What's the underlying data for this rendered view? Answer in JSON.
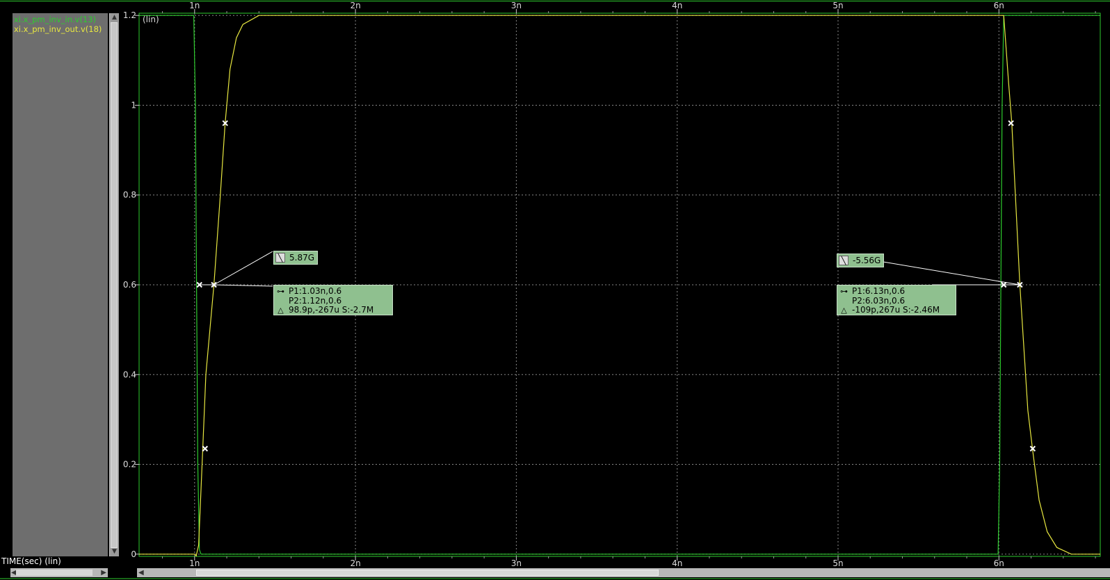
{
  "chart_data": {
    "type": "line",
    "xlabel": "TIME(sec) (lin)",
    "ylabel_unit": "(lin)",
    "xlim": [
      0.655,
      6.63
    ],
    "ylim": [
      -0.005,
      1.205
    ],
    "x_ticks": [
      {
        "value": 1,
        "label": "1n"
      },
      {
        "value": 2,
        "label": "2n"
      },
      {
        "value": 3,
        "label": "3n"
      },
      {
        "value": 4,
        "label": "4n"
      },
      {
        "value": 5,
        "label": "5n"
      },
      {
        "value": 6,
        "label": "6n"
      }
    ],
    "y_ticks": [
      {
        "value": 0,
        "label": "0"
      },
      {
        "value": 0.2,
        "label": "0.2"
      },
      {
        "value": 0.4,
        "label": "0.4"
      },
      {
        "value": 0.6,
        "label": "0.6"
      },
      {
        "value": 0.8,
        "label": "0.8"
      },
      {
        "value": 1,
        "label": "1"
      },
      {
        "value": 1.2,
        "label": "1.2"
      }
    ],
    "grid": true,
    "series": [
      {
        "name": "xi.x_pm_inv_in.v(13)",
        "color": "#2ecc2e",
        "points": [
          [
            0.655,
            1.2
          ],
          [
            0.995,
            1.2
          ],
          [
            1.005,
            1.0
          ],
          [
            1.012,
            0.6
          ],
          [
            1.02,
            0.2
          ],
          [
            1.03,
            0.01
          ],
          [
            1.04,
            0.0
          ],
          [
            5.995,
            0.0
          ],
          [
            6.005,
            0.2
          ],
          [
            6.012,
            0.6
          ],
          [
            6.02,
            1.0
          ],
          [
            6.03,
            1.2
          ],
          [
            6.63,
            1.2
          ]
        ]
      },
      {
        "name": "xi.x_pm_inv_out.v(18)",
        "color": "#e8e840",
        "points": [
          [
            0.655,
            0.0
          ],
          [
            1.0,
            0.0
          ],
          [
            1.01,
            -0.004
          ],
          [
            1.025,
            0.02
          ],
          [
            1.05,
            0.23
          ],
          [
            1.07,
            0.4
          ],
          [
            1.12,
            0.6
          ],
          [
            1.16,
            0.8
          ],
          [
            1.19,
            0.96
          ],
          [
            1.22,
            1.08
          ],
          [
            1.26,
            1.15
          ],
          [
            1.3,
            1.18
          ],
          [
            1.4,
            1.2
          ],
          [
            6.63,
            1.2
          ],
          [
            6.63,
            1.2
          ]
        ],
        "fall_points": [
          [
            6.0,
            1.2
          ],
          [
            6.03,
            1.2
          ],
          [
            6.06,
            1.05
          ],
          [
            6.08,
            0.96
          ],
          [
            6.13,
            0.6
          ],
          [
            6.18,
            0.32
          ],
          [
            6.21,
            0.23
          ],
          [
            6.25,
            0.12
          ],
          [
            6.3,
            0.05
          ],
          [
            6.36,
            0.015
          ],
          [
            6.45,
            0.0
          ],
          [
            6.5,
            0.0
          ]
        ]
      }
    ],
    "markers": [
      {
        "x": 1.03,
        "y": 0.6
      },
      {
        "x": 1.12,
        "y": 0.6
      },
      {
        "x": 1.19,
        "y": 0.96
      },
      {
        "x": 1.065,
        "y": 0.235
      },
      {
        "x": 6.03,
        "y": 0.6
      },
      {
        "x": 6.13,
        "y": 0.6
      },
      {
        "x": 6.075,
        "y": 0.96
      },
      {
        "x": 6.21,
        "y": 0.235
      }
    ],
    "annotations": [
      {
        "slope_label": "5.87G",
        "p1": "P1:1.03n,0.6",
        "p2": "P2:1.12n,0.6",
        "delta": "98.9p,-267u S:-2.7M"
      },
      {
        "slope_label": "-5.56G",
        "p1": "P1:6.13n,0.6",
        "p2": "P2:6.03n,0.6",
        "delta": "-109p,267u S:-2.46M"
      }
    ]
  },
  "legend": {
    "entries": [
      {
        "label": "xi.x_pm_inv_in.v(13)",
        "color": "#2ecc2e"
      },
      {
        "label": "xi.x_pm_inv_out.v(18)",
        "color": "#e8e840"
      }
    ]
  },
  "colors": {
    "grid": "#888888",
    "frame": "#2ecc2e",
    "background": "#000000",
    "marker_box": "#8fc08f"
  }
}
